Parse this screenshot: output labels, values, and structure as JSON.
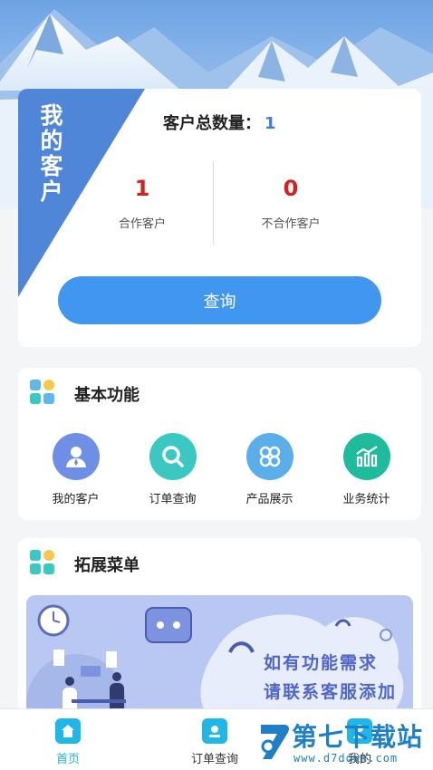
{
  "summary": {
    "ribbon_title": "我的客户",
    "total_label": "客户总数量：",
    "total_value": "1",
    "cooperating_value": "1",
    "cooperating_label": "合作客户",
    "non_cooperating_value": "0",
    "non_cooperating_label": "不合作客户",
    "query_button": "查询"
  },
  "basic": {
    "title": "基本功能",
    "items": [
      {
        "label": "我的客户",
        "icon": "user-icon",
        "color": "#6f8fe6"
      },
      {
        "label": "订单查询",
        "icon": "search-icon",
        "color": "#3cc8c2"
      },
      {
        "label": "产品展示",
        "icon": "clover-icon",
        "color": "#5aaeea"
      },
      {
        "label": "业务统计",
        "icon": "chart-icon",
        "color": "#1ebc9c"
      }
    ]
  },
  "extension": {
    "title": "拓展菜单",
    "banner_line1": "如有功能需求",
    "banner_line2": "请联系客服添加"
  },
  "nav": {
    "items": [
      {
        "label": "首页",
        "icon": "home-icon",
        "active": true
      },
      {
        "label": "订单查询",
        "icon": "order-icon",
        "active": false
      },
      {
        "label": "我的",
        "icon": "profile-icon",
        "active": false
      }
    ]
  },
  "watermark": {
    "title": "第七下载站",
    "url": "www.d7down.com"
  },
  "colors": {
    "accent": "#4196f0",
    "ribbon": "#4f86d8",
    "stat_value": "#d61f1f",
    "total_value": "#3b82d6",
    "nav_active": "#1fb6e8"
  }
}
